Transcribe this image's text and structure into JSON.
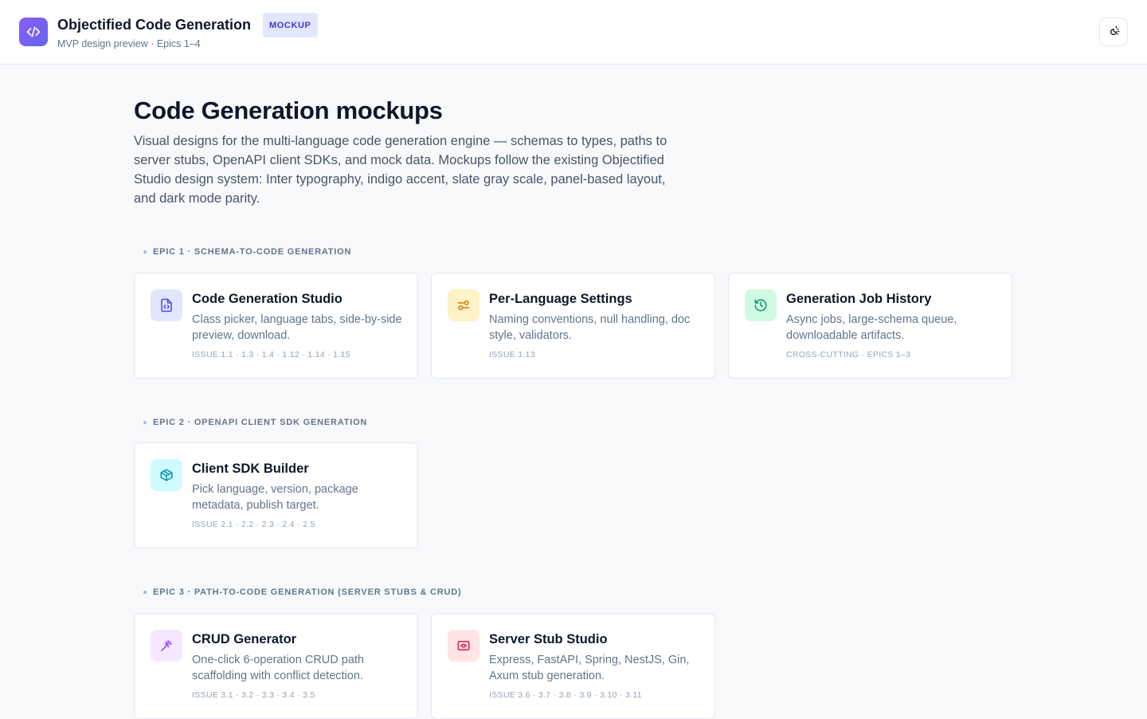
{
  "header": {
    "title": "Objectified Code Generation",
    "badge": "MOCKUP",
    "subtitle": "MVP design preview · Epics 1–4",
    "logo_icon": "code-icon",
    "theme_icon": "theme-toggle-icon"
  },
  "page": {
    "title": "Code Generation mockups",
    "intro": "Visual designs for the multi-language code generation engine — schemas to types, paths to server stubs, OpenAPI client SDKs, and mock data. Mockups follow the existing Objectified Studio design system: Inter typography, indigo accent, slate gray scale, panel-based layout, and dark mode parity."
  },
  "sections": [
    {
      "label": "EPIC 1 · SCHEMA-TO-CODE GENERATION",
      "cards": [
        {
          "title": "Code Generation Studio",
          "desc": "Class picker, language tabs, side-by-side preview, download.",
          "meta": "ISSUE 1.1 · 1.3 · 1.4 · 1.12 · 1.14 · 1.15",
          "icon": "file-code-icon",
          "accent": "#4f46e5",
          "bg": "#e0e7ff"
        },
        {
          "title": "Per-Language Settings",
          "desc": "Naming conventions, null handling, doc style, validators.",
          "meta": "ISSUE 1.13",
          "icon": "sliders-icon",
          "accent": "#d97706",
          "bg": "#fef3c7"
        },
        {
          "title": "Generation Job History",
          "desc": "Async jobs, large-schema queue, downloadable artifacts.",
          "meta": "CROSS-CUTTING · EPICS 1–3",
          "icon": "history-icon",
          "accent": "#059669",
          "bg": "#d1fae5"
        }
      ]
    },
    {
      "label": "EPIC 2 · OPENAPI CLIENT SDK GENERATION",
      "cards": [
        {
          "title": "Client SDK Builder",
          "desc": "Pick language, version, package metadata, publish target.",
          "meta": "ISSUE 2.1 · 2.2 · 2.3 · 2.4 · 2.5",
          "icon": "package-icon",
          "accent": "#0891b2",
          "bg": "#cffafe"
        }
      ]
    },
    {
      "label": "EPIC 3 · PATH-TO-CODE GENERATION (SERVER STUBS & CRUD)",
      "cards": [
        {
          "title": "CRUD Generator",
          "desc": "One-click 6-operation CRUD path scaffolding with conflict detection.",
          "meta": "ISSUE 3.1 · 3.2 · 3.3 · 3.4 · 3.5",
          "icon": "magic-wand-icon",
          "accent": "#9333ea",
          "bg": "#f3e8ff"
        },
        {
          "title": "Server Stub Studio",
          "desc": "Express, FastAPI, Spring, NestJS, Gin, Axum stub generation.",
          "meta": "ISSUE 3.6 · 3.7 · 3.8 · 3.9 · 3.10 · 3.11",
          "icon": "server-icon",
          "accent": "#e11d48",
          "bg": "#ffe4e6"
        }
      ]
    }
  ]
}
